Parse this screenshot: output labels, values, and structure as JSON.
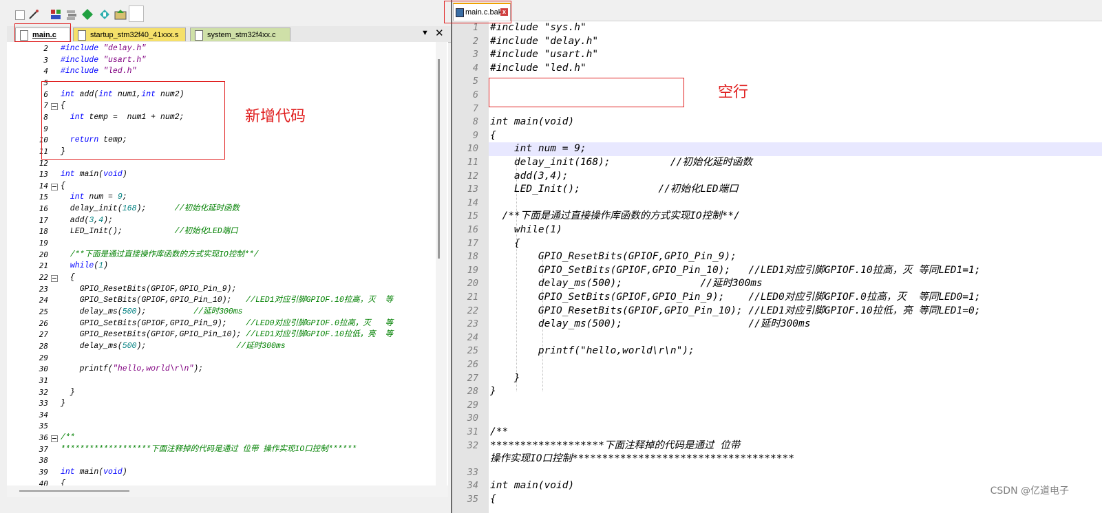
{
  "left_editor": {
    "tabs": [
      {
        "label": "main.c",
        "active": true
      },
      {
        "label": "startup_stm32f40_41xxx.s",
        "active": false
      },
      {
        "label": "system_stm32f4xx.c",
        "active": false
      }
    ],
    "tab_menu_icon": "chevron-down-icon",
    "tab_close_icon": "close-icon",
    "annotation_label": "新增代码",
    "lines": [
      {
        "n": "2",
        "html": "<span class=\"kw\">#include</span> <span class=\"str\">\"delay.h\"</span>"
      },
      {
        "n": "3",
        "html": "<span class=\"kw\">#include</span> <span class=\"str\">\"usart.h\"</span>"
      },
      {
        "n": "4",
        "html": "<span class=\"kw\">#include</span> <span class=\"str\">\"led.h\"</span>"
      },
      {
        "n": "5",
        "html": ""
      },
      {
        "n": "6",
        "html": "<span class=\"kw\">int</span> add(<span class=\"kw\">int</span> num1,<span class=\"kw\">int</span> num2)"
      },
      {
        "n": "7",
        "html": "{",
        "fold": true
      },
      {
        "n": "8",
        "html": "  <span class=\"kw\">int</span> temp =  num1 + num2;"
      },
      {
        "n": "9",
        "html": ""
      },
      {
        "n": "10",
        "html": "  <span class=\"kw\">return</span> temp;"
      },
      {
        "n": "11",
        "html": "}"
      },
      {
        "n": "12",
        "html": ""
      },
      {
        "n": "13",
        "html": "<span class=\"kw\">int</span> main(<span class=\"kw\">void</span>)"
      },
      {
        "n": "14",
        "html": "{",
        "fold": true
      },
      {
        "n": "15",
        "html": "  <span class=\"kw\">int</span> num = <span class=\"num\">9</span>;"
      },
      {
        "n": "16",
        "html": "  delay_init(<span class=\"num\">168</span>);      <span class=\"cmt\">//初始化延时函数</span>"
      },
      {
        "n": "17",
        "html": "  add(<span class=\"num\">3</span>,<span class=\"num\">4</span>);"
      },
      {
        "n": "18",
        "html": "  LED_Init();           <span class=\"cmt\">//初始化LED端口</span>"
      },
      {
        "n": "19",
        "html": ""
      },
      {
        "n": "20",
        "html": "  <span class=\"cmt\">/**下面是通过直接操作库函数的方式实现IO控制**/</span>"
      },
      {
        "n": "21",
        "html": "  <span class=\"kw\">while</span>(<span class=\"num\">1</span>)"
      },
      {
        "n": "22",
        "html": "  {",
        "fold": true
      },
      {
        "n": "23",
        "html": "    GPIO_ResetBits(GPIOF,GPIO_Pin_9);"
      },
      {
        "n": "24",
        "html": "    GPIO_SetBits(GPIOF,GPIO_Pin_10);   <span class=\"cmt\">//LED1对应引脚GPIOF.10拉高，灭  等</span>"
      },
      {
        "n": "25",
        "html": "    delay_ms(<span class=\"num\">500</span>);          <span class=\"cmt\">//延时300ms</span>"
      },
      {
        "n": "26",
        "html": "    GPIO_SetBits(GPIOF,GPIO_Pin_9);    <span class=\"cmt\">//LED0对应引脚GPIOF.0拉高，灭   等</span>"
      },
      {
        "n": "27",
        "html": "    GPIO_ResetBits(GPIOF,GPIO_Pin_10); <span class=\"cmt\">//LED1对应引脚GPIOF.10拉低，亮  等</span>"
      },
      {
        "n": "28",
        "html": "    delay_ms(<span class=\"num\">500</span>);                   <span class=\"cmt\">//延时300ms</span>"
      },
      {
        "n": "29",
        "html": ""
      },
      {
        "n": "30",
        "html": "    printf(<span class=\"str\">\"hello,world\\r\\n\"</span>);"
      },
      {
        "n": "31",
        "html": ""
      },
      {
        "n": "32",
        "html": "  }"
      },
      {
        "n": "33",
        "html": "}"
      },
      {
        "n": "34",
        "html": ""
      },
      {
        "n": "35",
        "html": ""
      },
      {
        "n": "36",
        "html": "<span class=\"cmt\">/**</span>",
        "fold": true
      },
      {
        "n": "37",
        "html": "<span class=\"cmt\">*******************下面注释掉的代码是通过 位带 操作实现IO口控制******</span>"
      },
      {
        "n": "38",
        "html": ""
      },
      {
        "n": "39",
        "html": "<span class=\"kw\">int</span> main(<span class=\"kw\">void</span>)"
      },
      {
        "n": "40",
        "html": "{"
      }
    ]
  },
  "right_editor": {
    "tab_label": "main.c.bak",
    "tab_close_icon": "close-icon",
    "annotation_label": "空行",
    "watermark": "CSDN @亿道电子",
    "lines": [
      {
        "n": "1",
        "text": "#include \"sys.h\""
      },
      {
        "n": "2",
        "text": "#include \"delay.h\""
      },
      {
        "n": "3",
        "text": "#include \"usart.h\""
      },
      {
        "n": "4",
        "text": "#include \"led.h\""
      },
      {
        "n": "5",
        "text": ""
      },
      {
        "n": "6",
        "text": ""
      },
      {
        "n": "7",
        "text": ""
      },
      {
        "n": "8",
        "text": "int main(void)"
      },
      {
        "n": "9",
        "text": "{"
      },
      {
        "n": "10",
        "text": "    int num = 9;",
        "highlight": true
      },
      {
        "n": "11",
        "text": "    delay_init(168);          //初始化延时函数"
      },
      {
        "n": "12",
        "text": "    add(3,4);"
      },
      {
        "n": "13",
        "text": "    LED_Init();             //初始化LED端口"
      },
      {
        "n": "14",
        "text": ""
      },
      {
        "n": "15",
        "text": "  /**下面是通过直接操作库函数的方式实现IO控制**/"
      },
      {
        "n": "16",
        "text": "    while(1)"
      },
      {
        "n": "17",
        "text": "    {"
      },
      {
        "n": "18",
        "text": "        GPIO_ResetBits(GPIOF,GPIO_Pin_9);"
      },
      {
        "n": "19",
        "text": "        GPIO_SetBits(GPIOF,GPIO_Pin_10);   //LED1对应引脚GPIOF.10拉高，灭 等同LED1=1;"
      },
      {
        "n": "20",
        "text": "        delay_ms(500);             //延时300ms"
      },
      {
        "n": "21",
        "text": "        GPIO_SetBits(GPIOF,GPIO_Pin_9);    //LED0对应引脚GPIOF.0拉高，灭  等同LED0=1;"
      },
      {
        "n": "22",
        "text": "        GPIO_ResetBits(GPIOF,GPIO_Pin_10); //LED1对应引脚GPIOF.10拉低，亮 等同LED1=0;"
      },
      {
        "n": "23",
        "text": "        delay_ms(500);                     //延时300ms"
      },
      {
        "n": "24",
        "text": ""
      },
      {
        "n": "25",
        "text": "        printf(\"hello,world\\r\\n\");"
      },
      {
        "n": "26",
        "text": ""
      },
      {
        "n": "27",
        "text": "    }"
      },
      {
        "n": "28",
        "text": "}"
      },
      {
        "n": "29",
        "text": ""
      },
      {
        "n": "30",
        "text": ""
      },
      {
        "n": "31",
        "text": "/**"
      },
      {
        "n": "32",
        "text": "*******************下面注释掉的代码是通过 位带"
      },
      {
        "n": "",
        "text": "操作实现IO口控制*************************************"
      },
      {
        "n": "33",
        "text": ""
      },
      {
        "n": "34",
        "text": "int main(void)"
      },
      {
        "n": "35",
        "text": "{"
      }
    ]
  },
  "colors": {
    "annotation_red": "#e02020",
    "keyword_blue": "#0000ff",
    "string_purple": "#800080",
    "comment_green": "#008000",
    "number_teal": "#008080",
    "current_line_highlight": "#e8e8ff"
  }
}
